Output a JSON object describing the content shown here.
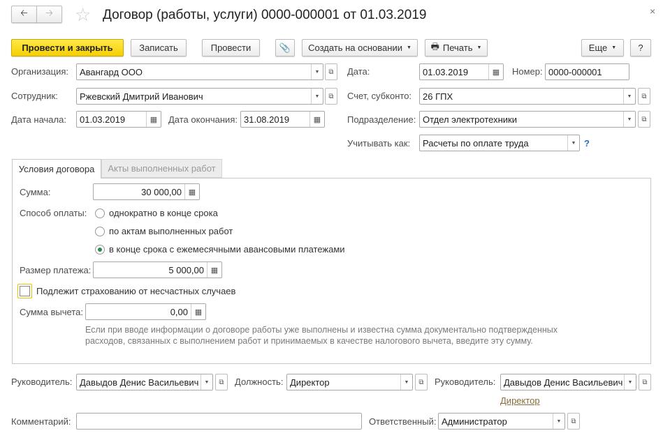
{
  "header": {
    "title": "Договор (работы, услуги) 0000-000001 от 01.03.2019",
    "close": "×"
  },
  "toolbar": {
    "post_close": "Провести и закрыть",
    "save": "Записать",
    "post": "Провести",
    "create_based": "Создать на основании",
    "print": "Печать",
    "more": "Еще",
    "help": "?"
  },
  "form": {
    "org_label": "Организация:",
    "org": "Авангард ООО",
    "date_label": "Дата:",
    "date": "01.03.2019",
    "number_label": "Номер:",
    "number": "0000-000001",
    "employee_label": "Сотрудник:",
    "employee": "Ржевский Дмитрий Иванович",
    "account_label": "Счет, субконто:",
    "account": "26 ГПХ",
    "start_label": "Дата начала:",
    "start": "01.03.2019",
    "end_label": "Дата окончания:",
    "end": "31.08.2019",
    "dept_label": "Подразделение:",
    "dept": "Отдел электротехники",
    "account_as_label": "Учитывать как:",
    "account_as": "Расчеты по оплате труда",
    "account_as_help": "?"
  },
  "tabs": [
    {
      "label": "Условия договора",
      "active": true
    },
    {
      "label": "Акты выполненных работ",
      "active": false
    }
  ],
  "terms": {
    "sum_label": "Сумма:",
    "sum": "30 000,00",
    "payment_label": "Способ оплаты:",
    "payment_options": [
      {
        "label": "однократно в конце срока",
        "selected": false
      },
      {
        "label": "по актам выполненных работ",
        "selected": false
      },
      {
        "label": "в конце срока с ежемесячными авансовыми платежами",
        "selected": true
      }
    ],
    "payment_size_label": "Размер платежа:",
    "payment_size": "5 000,00",
    "insurance_label": "Подлежит страхованию от несчастных случаев",
    "insurance": false,
    "deduction_label": "Сумма вычета:",
    "deduction": "0,00",
    "note": "Если при вводе информации о договоре работы уже выполнены и известна сумма документально подтвержденных расходов, связанных с выполнением работ и принимаемых в качестве налогового вычета, введите эту сумму."
  },
  "footer": {
    "head_label": "Руководитель:",
    "head": "Давыдов Денис Васильевич",
    "position_label": "Должность:",
    "position": "Директор",
    "head2_label": "Руководитель:",
    "head2": "Давыдов Денис Васильевич",
    "head2_position_link": "Директор",
    "comment_label": "Комментарий:",
    "comment": "",
    "responsible_label": "Ответственный:",
    "responsible": "Администратор"
  }
}
